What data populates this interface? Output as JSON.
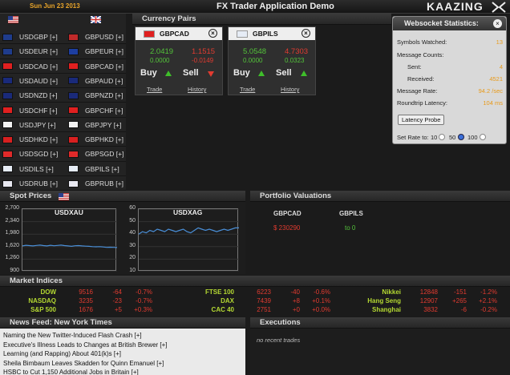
{
  "header": {
    "date": "Sun Jun 23 2013",
    "title": "FX Trader Application Demo",
    "logo": "KAAZING"
  },
  "symbols": [
    {
      "left": "USDGBP [+]",
      "right": "GBPUSD [+]",
      "left_flag": "#1f3c8c",
      "right_flag": "#bf2a2a"
    },
    {
      "left": "USDEUR [+]",
      "right": "GBPEUR [+]",
      "left_flag": "#1f3c8c",
      "right_flag": "#1d3ea0"
    },
    {
      "left": "USDCAD [+]",
      "right": "GBPCAD [+]",
      "left_flag": "#e02020",
      "right_flag": "#e02020"
    },
    {
      "left": "USDAUD [+]",
      "right": "GBPAUD [+]",
      "left_flag": "#1a2a7a",
      "right_flag": "#1a2a7a"
    },
    {
      "left": "USDNZD [+]",
      "right": "GBPNZD [+]",
      "left_flag": "#1a2a7a",
      "right_flag": "#1a2a7a"
    },
    {
      "left": "USDCHF [+]",
      "right": "GBPCHF [+]",
      "left_flag": "#e02020",
      "right_flag": "#e02020"
    },
    {
      "left": "USDJPY [+]",
      "right": "GBPJPY [+]",
      "left_flag": "#f2f2f2",
      "right_flag": "#f2f2f2"
    },
    {
      "left": "USDHKD [+]",
      "right": "GBPHKD [+]",
      "left_flag": "#d82020",
      "right_flag": "#d82020"
    },
    {
      "left": "USDSGD [+]",
      "right": "GBPSGD [+]",
      "left_flag": "#e02a2a",
      "right_flag": "#e02a2a"
    },
    {
      "left": "USDILS [+]",
      "right": "GBPILS [+]",
      "left_flag": "#e6ecf5",
      "right_flag": "#e6ecf5"
    },
    {
      "left": "USDRUB [+]",
      "right": "GBPRUB [+]",
      "left_flag": "#e8e8f0",
      "right_flag": "#e8e8f0"
    }
  ],
  "currency_pairs": {
    "title": "Currency Pairs",
    "cards": [
      {
        "pair": "GBPCAD",
        "bid": "2.0419",
        "ask": "1.1515",
        "bid_change": "0.0000",
        "ask_change": "-0.0149",
        "buy": "Buy",
        "sell": "Sell",
        "trade": "Trade",
        "history": "History",
        "flag": "#e02020",
        "sell_dir": "down"
      },
      {
        "pair": "GBPILS",
        "bid": "5.0548",
        "ask": "4.7303",
        "bid_change": "0.0000",
        "ask_change": "0.0323",
        "buy": "Buy",
        "sell": "Sell",
        "trade": "Trade",
        "history": "History",
        "flag": "#e6ecf5",
        "sell_dir": "up"
      }
    ]
  },
  "websocket": {
    "title": "Websocket Statistics:",
    "symbols_watched_label": "Symbols Watched:",
    "symbols_watched": "13",
    "message_counts_label": "Message Counts:",
    "sent_label": "Sent:",
    "sent": "4",
    "received_label": "Received:",
    "received": "4521",
    "message_rate_label": "Message Rate:",
    "message_rate": "94.2 /sec",
    "latency_label": "Roundtrip Latency:",
    "latency": "104 ms",
    "probe_button": "Latency Probe",
    "rate_label": "Set Rate to:",
    "rates": [
      "10",
      "50",
      "100"
    ],
    "selected_rate": "100"
  },
  "spot_prices": {
    "title": "Spot Prices"
  },
  "chart_data": [
    {
      "type": "line",
      "title": "USDXAU",
      "yticks": [
        "2,700",
        "2,340",
        "1,980",
        "1,620",
        "1,260",
        "900"
      ],
      "ylim": [
        900,
        2700
      ],
      "values": [
        1640,
        1660,
        1650,
        1640,
        1655,
        1665,
        1650,
        1640,
        1660,
        1645,
        1655,
        1665,
        1650,
        1640,
        1630,
        1645,
        1650,
        1640,
        1635,
        1630,
        1620,
        1615,
        1620,
        1610,
        1600,
        1605,
        1600,
        1595
      ]
    },
    {
      "type": "line",
      "title": "USDXAG",
      "yticks": [
        "60",
        "50",
        "40",
        "30",
        "20",
        "10"
      ],
      "ylim": [
        10,
        60
      ],
      "values": [
        40,
        42,
        41,
        43,
        42,
        44,
        43,
        42,
        44,
        43,
        42,
        43,
        44,
        42,
        41,
        43,
        45,
        44,
        43,
        44,
        43,
        42,
        43,
        44,
        43,
        44,
        45,
        45
      ]
    }
  ],
  "portfolio": {
    "title": "Portfolio Valuations",
    "columns": [
      {
        "name": "GBPCAD",
        "value": "$ 230290",
        "color": "#e23b30"
      },
      {
        "name": "GBPILS",
        "value": "to 0",
        "color": "#53c23a"
      }
    ]
  },
  "market_indices": {
    "title": "Market Indices",
    "items": [
      {
        "name": "DOW",
        "value": "9516",
        "change": "-64",
        "pct": "-0.7%"
      },
      {
        "name": "NASDAQ",
        "value": "3235",
        "change": "-23",
        "pct": "-0.7%"
      },
      {
        "name": "S&P 500",
        "value": "1676",
        "change": "+5",
        "pct": "+0.3%"
      },
      {
        "name": "FTSE 100",
        "value": "6223",
        "change": "-40",
        "pct": "-0.6%"
      },
      {
        "name": "DAX",
        "value": "7439",
        "change": "+8",
        "pct": "+0.1%"
      },
      {
        "name": "CAC 40",
        "value": "2751",
        "change": "+0",
        "pct": "+0.0%"
      },
      {
        "name": "Nikkei",
        "value": "12848",
        "change": "-151",
        "pct": "-1.2%"
      },
      {
        "name": "Hang Seng",
        "value": "12907",
        "change": "+265",
        "pct": "+2.1%"
      },
      {
        "name": "Shanghai",
        "value": "3832",
        "change": "-6",
        "pct": "-0.2%"
      }
    ]
  },
  "news": {
    "title": "News Feed:  New York Times",
    "items": [
      "Naming the New Twitter-Induced Flash Crash  [+]",
      "Executive's Illness Leads to Changes at British Brewer  [+]",
      "Learning (and Rapping) About 401(k)s  [+]",
      "Sheila Bimbaum Leaves Skadden for Quinn Emanuel  [+]",
      "HSBC to Cut 1,150 Additional Jobs in Britain  [+]"
    ]
  },
  "executions": {
    "title": "Executions",
    "empty": "no recent trades"
  }
}
